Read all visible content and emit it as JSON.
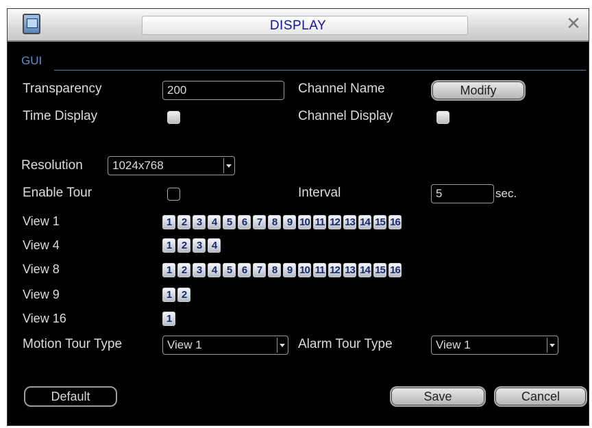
{
  "window": {
    "title": "DISPLAY"
  },
  "section": {
    "gui_label": "GUI"
  },
  "transparency": {
    "label": "Transparency",
    "value": "200"
  },
  "channel_name": {
    "label": "Channel Name",
    "button": "Modify"
  },
  "time_display": {
    "label": "Time Display",
    "checked": true
  },
  "channel_display": {
    "label": "Channel Display",
    "checked": true
  },
  "resolution": {
    "label": "Resolution",
    "value": "1024x768"
  },
  "enable_tour": {
    "label": "Enable Tour",
    "checked": false
  },
  "interval": {
    "label": "Interval",
    "value": "5",
    "unit": "sec."
  },
  "views": [
    {
      "label": "View 1",
      "channels": [
        "1",
        "2",
        "3",
        "4",
        "5",
        "6",
        "7",
        "8",
        "9",
        "10",
        "11",
        "12",
        "13",
        "14",
        "15",
        "16"
      ]
    },
    {
      "label": "View 4",
      "channels": [
        "1",
        "2",
        "3",
        "4"
      ]
    },
    {
      "label": "View 8",
      "channels": [
        "1",
        "2",
        "3",
        "4",
        "5",
        "6",
        "7",
        "8",
        "9",
        "10",
        "11",
        "12",
        "13",
        "14",
        "15",
        "16"
      ]
    },
    {
      "label": "View 9",
      "channels": [
        "1",
        "2"
      ]
    },
    {
      "label": "View 16",
      "channels": [
        "1"
      ]
    }
  ],
  "motion_tour": {
    "label": "Motion Tour Type",
    "value": "View 1"
  },
  "alarm_tour": {
    "label": "Alarm Tour Type",
    "value": "View 1"
  },
  "buttons": {
    "default": "Default",
    "save": "Save",
    "cancel": "Cancel"
  }
}
